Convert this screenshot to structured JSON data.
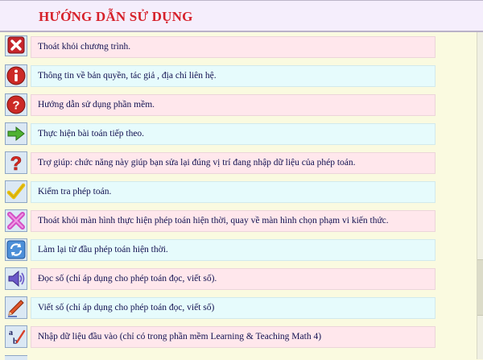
{
  "header": {
    "title": "HƯỚNG DẪN SỬ DỤNG"
  },
  "items": [
    {
      "icon": "close-x-icon",
      "style": "pink",
      "label": "Thoát khỏi chương trình."
    },
    {
      "icon": "info-icon",
      "style": "cyan",
      "label": "Thông tin về bản quyền, tác giả , địa chỉ liên hệ."
    },
    {
      "icon": "help-question-icon",
      "style": "pink",
      "label": "Hướng dẫn sử dụng phần mềm."
    },
    {
      "icon": "green-arrow-right-icon",
      "style": "cyan",
      "label": "Thực hiện bài toán tiếp theo."
    },
    {
      "icon": "red-question-mark-icon",
      "style": "pink",
      "label": "Trợ giúp: chức năng này giúp bạn sửa lại đúng vị trí đang nhập dữ liệu của phép toán."
    },
    {
      "icon": "checkmark-icon",
      "style": "cyan",
      "label": "Kiểm tra phép toán."
    },
    {
      "icon": "magenta-x-icon",
      "style": "pink",
      "label": "Thoát khỏi màn hình thực hiện phép toán hiện thời, quay về màn hình chọn phạm vi kiến thức."
    },
    {
      "icon": "refresh-icon",
      "style": "cyan",
      "label": "Làm lại từ đầu phép toán hiện thời."
    },
    {
      "icon": "speaker-icon",
      "style": "pink",
      "label": "Đọc số (chỉ áp dụng cho phép toán đọc, viết số)."
    },
    {
      "icon": "pencil-icon",
      "style": "cyan",
      "label": "Viết số (chỉ áp dụng cho phép toán đọc, viết số)"
    },
    {
      "icon": "input-data-icon",
      "style": "pink",
      "label": "Nhập dữ liệu đầu vào (chỉ có trong phần mềm Learning & Teaching Math 4)"
    }
  ],
  "colors": {
    "header_bg": "#f5eefc",
    "title": "#d6202a",
    "page_bg": "#fafae0",
    "row_pink": "#ffe7ec",
    "row_cyan": "#e6fbfc",
    "text": "#101050"
  }
}
